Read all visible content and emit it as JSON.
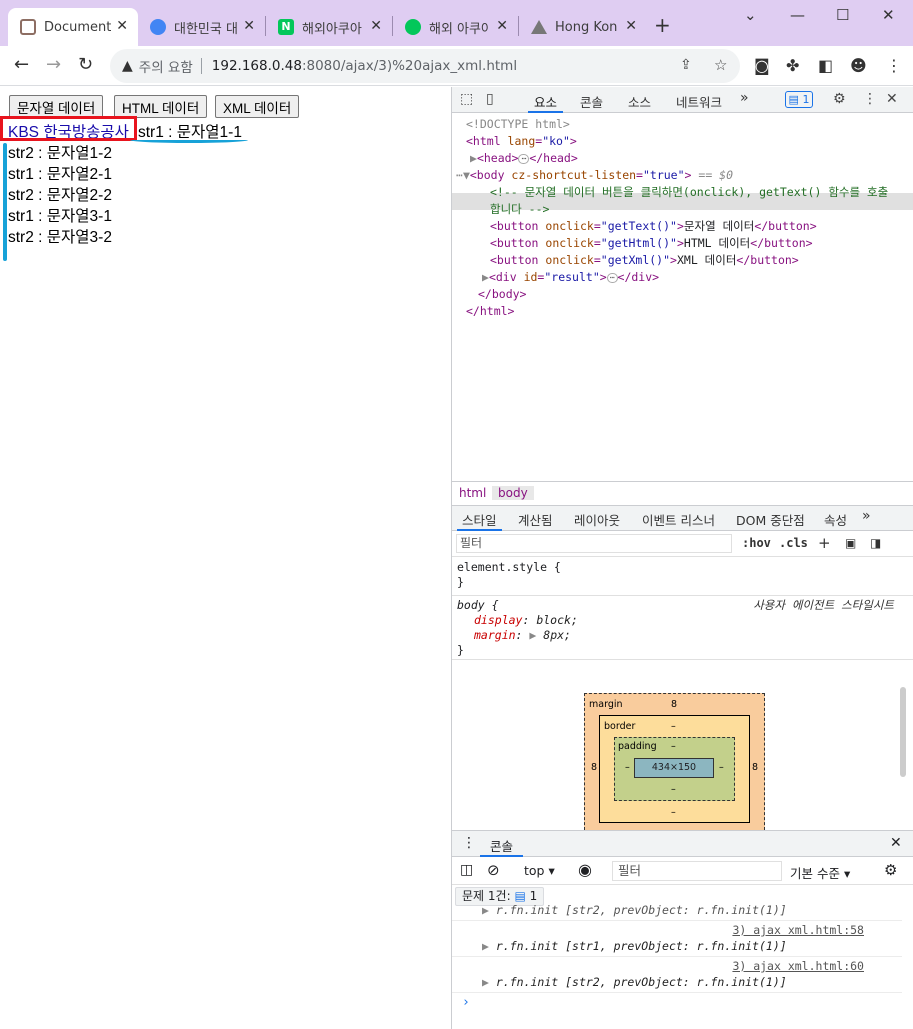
{
  "browser": {
    "tabs": [
      {
        "title": "Document",
        "active": true,
        "favicon_color": "#8d6e63",
        "favicon": "document-favicon-icon"
      },
      {
        "title": "대한민국 대",
        "active": false,
        "favicon_color": "#4285f4",
        "favicon": "globe-favicon-icon"
      },
      {
        "title": "해외아쿠아",
        "active": false,
        "favicon_color": "#03c75a",
        "favicon": "naver-favicon-icon"
      },
      {
        "title": "해외 아쿠아",
        "active": false,
        "favicon_color": "#03c75a",
        "favicon": "blog-favicon-icon"
      },
      {
        "title": "Hong Kong",
        "active": false,
        "favicon_color": "#777777",
        "favicon": "mountain-favicon-icon"
      }
    ],
    "new_tab": "+",
    "address": {
      "warning": "주의 요함",
      "host": "192.168.0.48",
      "rest": ":8080/ajax/3)%20ajax_xml.html"
    }
  },
  "page": {
    "buttons": [
      "문자열 데이터",
      "HTML 데이터",
      "XML 데이터"
    ],
    "link": "KBS 한국방송공사",
    "first_line": "str1 : 문자열1-1",
    "lines": [
      "str2 : 문자열1-2",
      "str1 : 문자열2-1",
      "str2 : 문자열2-2",
      "str1 : 문자열3-1",
      "str2 : 문자열3-2"
    ]
  },
  "devtools": {
    "tabs": [
      "요소",
      "콘솔",
      "소스",
      "네트워크"
    ],
    "more": "»",
    "issues_count": "1",
    "elements": {
      "doctype": "<!DOCTYPE html>",
      "html_open": "<html ",
      "html_attr": "lang",
      "html_val": "\"ko\"",
      "head": "<head>",
      "head_close": "</head>",
      "body_open": "<body ",
      "body_attr": "cz-shortcut-listen",
      "body_val": "\"true\"",
      "body_eq": "== $0",
      "comment_1": "<!-- 문자열 데이터 버튼을 클릭하면(onclick), getText() 함수를 호출",
      "comment_2": "합니다 -->",
      "btn1_val": "\"getText()\"",
      "btn1_text": "문자열 데이터",
      "btn2_val": "\"getHtml()\"",
      "btn2_text": "HTML 데이터",
      "btn3_val": "\"getXml()\"",
      "btn3_text": "XML 데이터",
      "div_val": "\"result\"",
      "body_close": "</body>",
      "html_close": "</html>"
    },
    "breadcrumbs": [
      "html",
      "body"
    ],
    "style_tabs": [
      "스타일",
      "계산됨",
      "레이아웃",
      "이벤트 리스너",
      "DOM 중단점",
      "속성"
    ],
    "filter_placeholder": "필터",
    "hov": ":hov",
    "cls": ".cls",
    "rules": {
      "element_style": "element.style {",
      "close": "}",
      "body_sel": "body {",
      "ua_label": "사용자 에이전트 스타일시트",
      "display_prop": "display",
      "display_val": "block;",
      "margin_prop": "margin",
      "margin_val": "8px;"
    },
    "box_model": {
      "margin_label": "margin",
      "margin_val": "8",
      "border_label": "border",
      "border_val": "–",
      "padding_label": "padding",
      "padding_val": "–",
      "content": "434×150",
      "left_margin": "8",
      "right_margin": "8"
    },
    "console": {
      "tab": "콘솔",
      "context": "top",
      "filter_placeholder": "필터",
      "levels": "기본 수준",
      "issues": "문제 1건:",
      "issues_count": "1",
      "logs": [
        {
          "msg": "r.fn.init [str2, prevObject: r.fn.init(1)]",
          "src": ""
        },
        {
          "msg": "r.fn.init [str1, prevObject: r.fn.init(1)]",
          "src": "3) ajax xml.html:58"
        },
        {
          "msg": "r.fn.init [str2, prevObject: r.fn.init(1)]",
          "src": "3) ajax xml.html:60"
        }
      ],
      "prompt": "›"
    }
  }
}
